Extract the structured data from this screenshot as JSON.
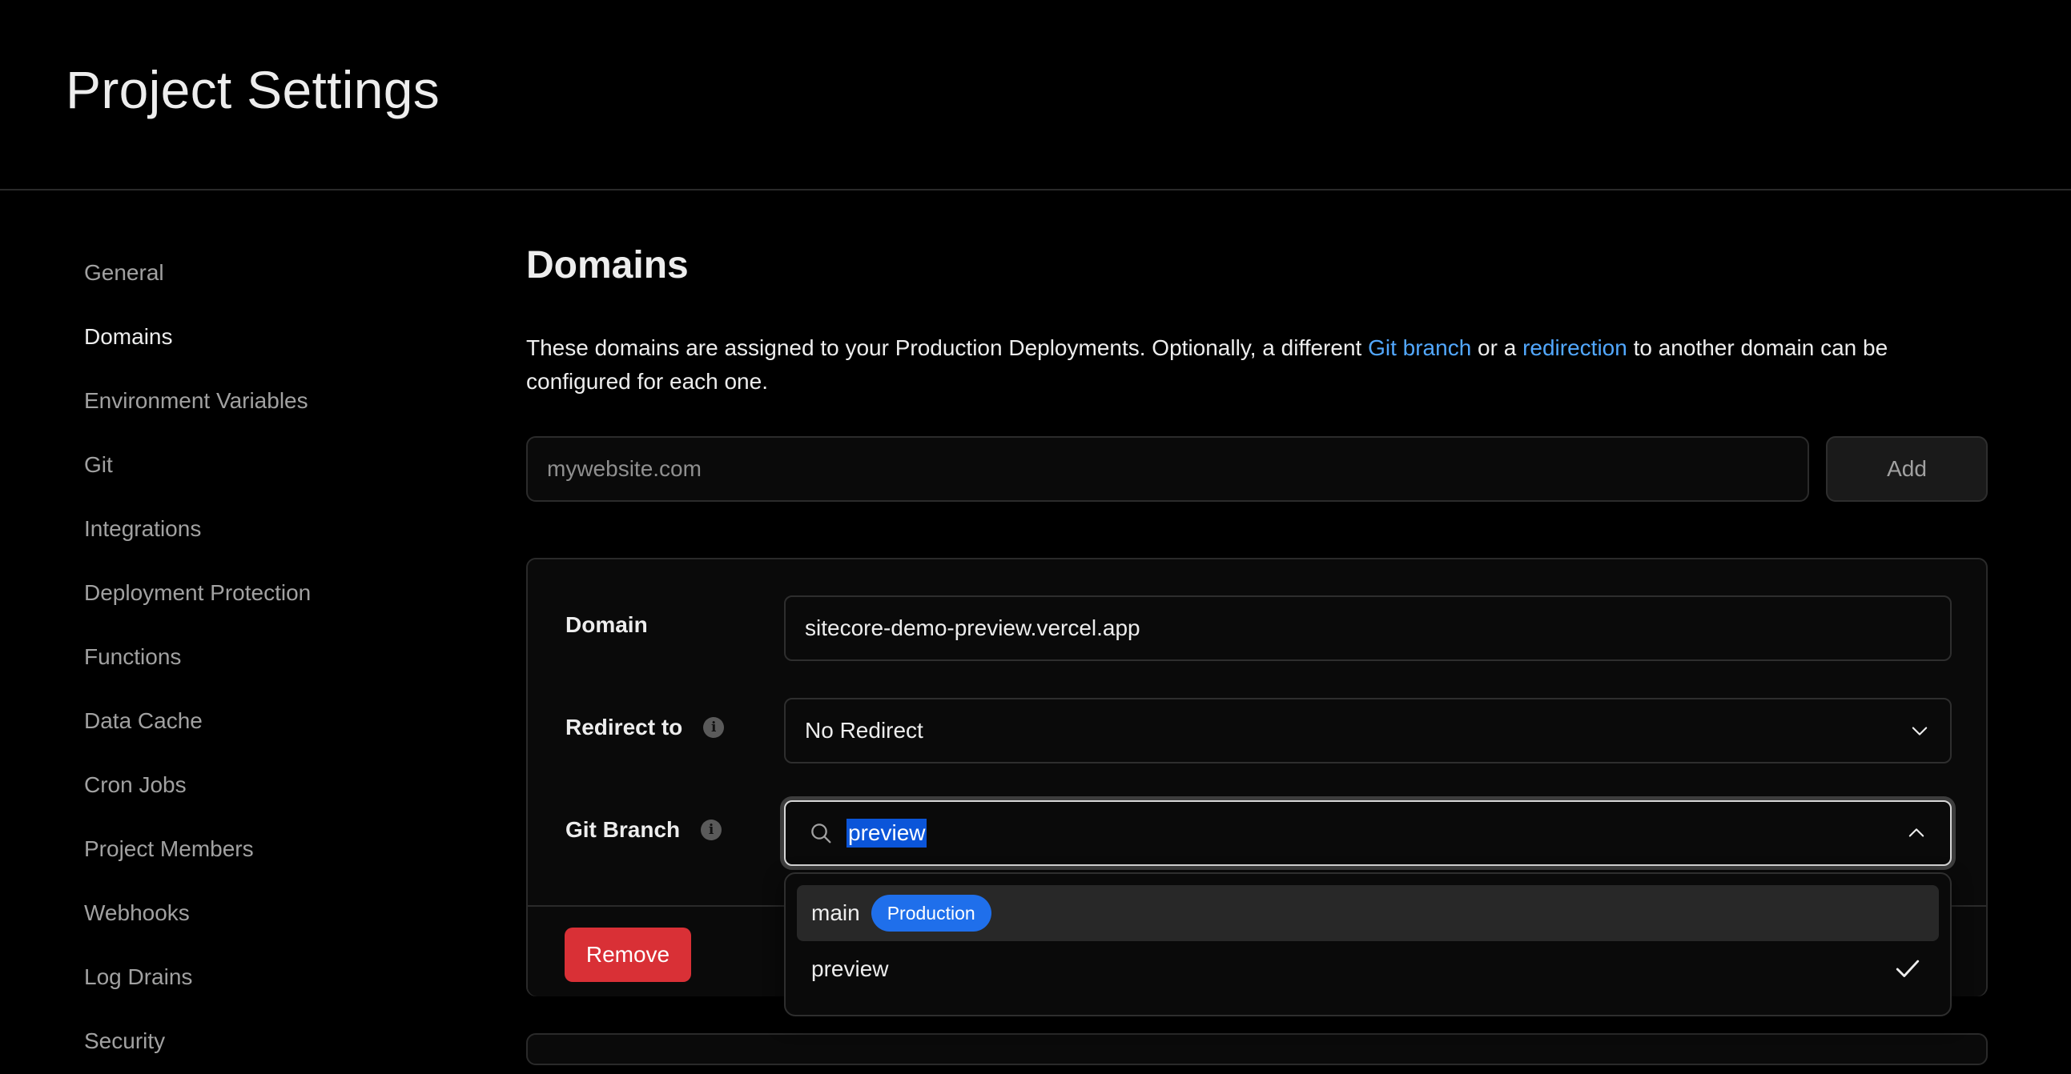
{
  "page": {
    "title": "Project Settings"
  },
  "sidebar": {
    "items": [
      {
        "label": "General"
      },
      {
        "label": "Domains",
        "active": true
      },
      {
        "label": "Environment Variables"
      },
      {
        "label": "Git"
      },
      {
        "label": "Integrations"
      },
      {
        "label": "Deployment Protection"
      },
      {
        "label": "Functions"
      },
      {
        "label": "Data Cache"
      },
      {
        "label": "Cron Jobs"
      },
      {
        "label": "Project Members"
      },
      {
        "label": "Webhooks"
      },
      {
        "label": "Log Drains"
      },
      {
        "label": "Security"
      }
    ]
  },
  "domains": {
    "title": "Domains",
    "description": {
      "part1": "These domains are assigned to your Production Deployments. Optionally, a different ",
      "link1": "Git branch",
      "part2": " or a ",
      "link2": "redirection",
      "part3": " to another domain can be configured for each one."
    },
    "add_input": {
      "placeholder": "mywebsite.com",
      "value": ""
    },
    "add_button": "Add",
    "card": {
      "domain_label": "Domain",
      "domain_value": "sitecore-demo-preview.vercel.app",
      "redirect_label": "Redirect to",
      "redirect_value": "No Redirect",
      "git_branch_label": "Git Branch",
      "git_branch_value": "preview",
      "remove_button": "Remove"
    },
    "branch_dropdown": {
      "options": [
        {
          "label": "main",
          "badge": "Production",
          "highlighted": true
        },
        {
          "label": "preview",
          "selected": true
        }
      ]
    }
  },
  "colors": {
    "background": "#000000",
    "link": "#52a8ff",
    "danger": "#d93036",
    "badge": "#1f6feb",
    "selection": "#0b55d9"
  }
}
